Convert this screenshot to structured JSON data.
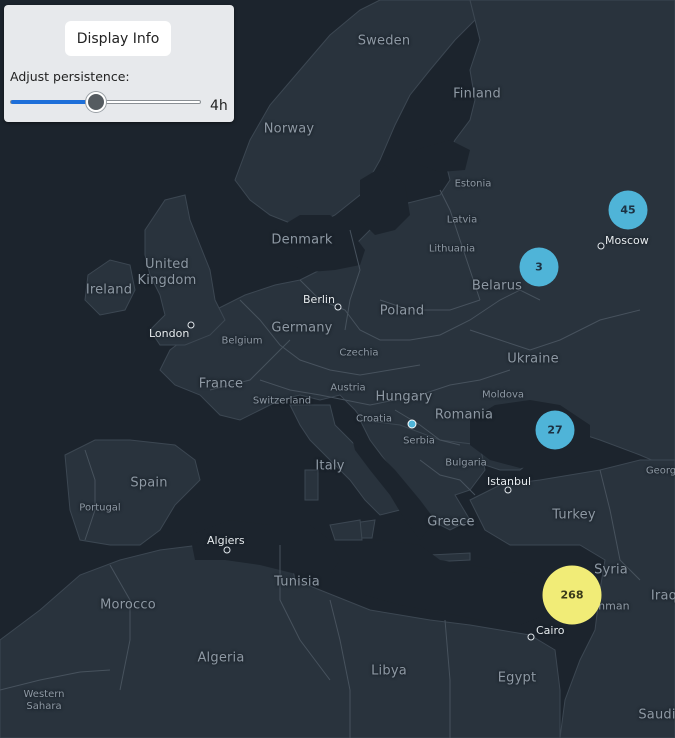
{
  "panel": {
    "button_label": "Display Info",
    "persistence_label": "Adjust persistence:",
    "persistence_value": "4h",
    "slider_fraction": 0.45
  },
  "map": {
    "countries": {
      "sweden": "Sweden",
      "finland": "Finland",
      "norway": "Norway",
      "estonia": "Estonia",
      "latvia": "Latvia",
      "lithuania": "Lithuania",
      "denmark": "Denmark",
      "united_kingdom": "United\nKingdom",
      "ireland": "Ireland",
      "belarus": "Belarus",
      "poland": "Poland",
      "germany": "Germany",
      "belgium": "Belgium",
      "czechia": "Czechia",
      "ukraine": "Ukraine",
      "france": "France",
      "austria": "Austria",
      "moldova": "Moldova",
      "hungary": "Hungary",
      "switzerland": "Switzerland",
      "romania": "Romania",
      "croatia": "Croatia",
      "serbia": "Serbia",
      "italy": "Italy",
      "bulgaria": "Bulgaria",
      "georgia": "Georg",
      "spain": "Spain",
      "portugal": "Portugal",
      "greece": "Greece",
      "turkey": "Turkey",
      "syria": "Syria",
      "iraq": "Iraq",
      "tunisia": "Tunisia",
      "morocco": "Morocco",
      "jordan": "mman",
      "algeria": "Algeria",
      "libya": "Libya",
      "egypt": "Egypt",
      "saudi": "Saudi",
      "western_sahara": "Western\nSahara"
    },
    "cities": {
      "moscow": "Moscow",
      "berlin": "Berlin",
      "london": "London",
      "istanbul": "Istanbul",
      "algiers": "Algiers",
      "cairo": "Cairo"
    },
    "clusters": [
      {
        "id": "cluster-45",
        "count": "45",
        "color": "#4fb4d8"
      },
      {
        "id": "cluster-3",
        "count": "3",
        "color": "#4fb4d8"
      },
      {
        "id": "cluster-27",
        "count": "27",
        "color": "#4fb4d8"
      },
      {
        "id": "cluster-268",
        "count": "268",
        "color": "#f1ec77"
      }
    ]
  },
  "colors": {
    "land": "#29333d",
    "water": "#1c242d",
    "border": "#4a5561",
    "cluster_small": "#4fb4d8",
    "cluster_large": "#f1ec77"
  }
}
